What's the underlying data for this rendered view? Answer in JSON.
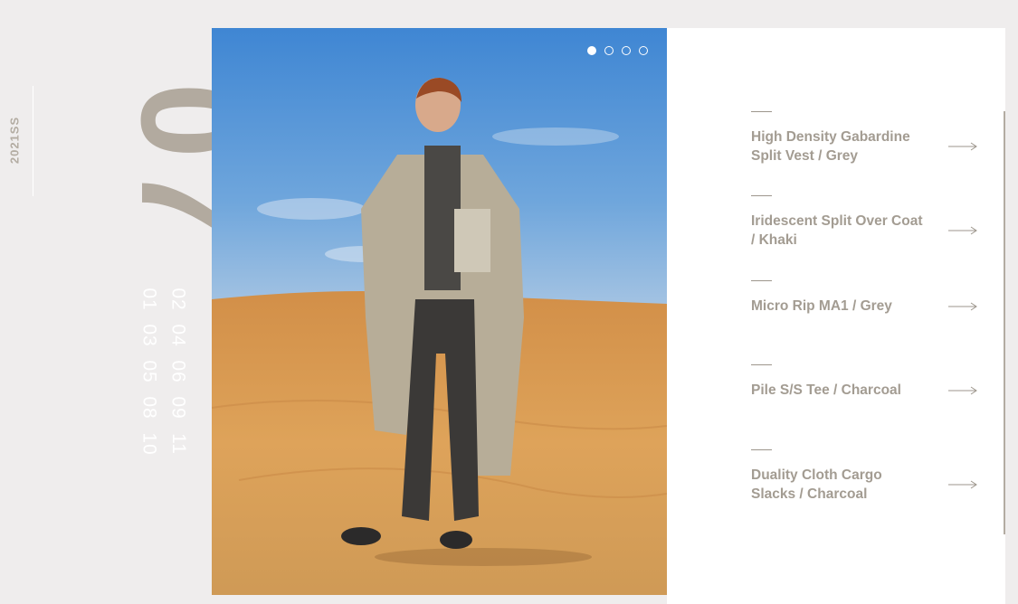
{
  "season": "2021SS",
  "look_number": "07",
  "index": {
    "left": [
      "01",
      "03",
      "05",
      "08",
      "10"
    ],
    "right": [
      "02",
      "04",
      "06",
      "09",
      "11"
    ]
  },
  "carousel": {
    "slides": 4,
    "active": 0
  },
  "products": [
    {
      "name": "High Density Gabardine Split Vest / Grey"
    },
    {
      "name": "Iridescent Split Over Coat / Khaki"
    },
    {
      "name": "Micro Rip MA1 / Grey"
    },
    {
      "name": "Pile S/S Tee / Charcoal"
    },
    {
      "name": "Duality Cloth Cargo Slacks / Charcoal"
    }
  ],
  "icons": {
    "arrow": "arrow-right-icon",
    "dot": "carousel-dot-icon"
  },
  "colors": {
    "accent": "#b2aa9f",
    "text": "#a39c92",
    "background": "#efeded"
  }
}
